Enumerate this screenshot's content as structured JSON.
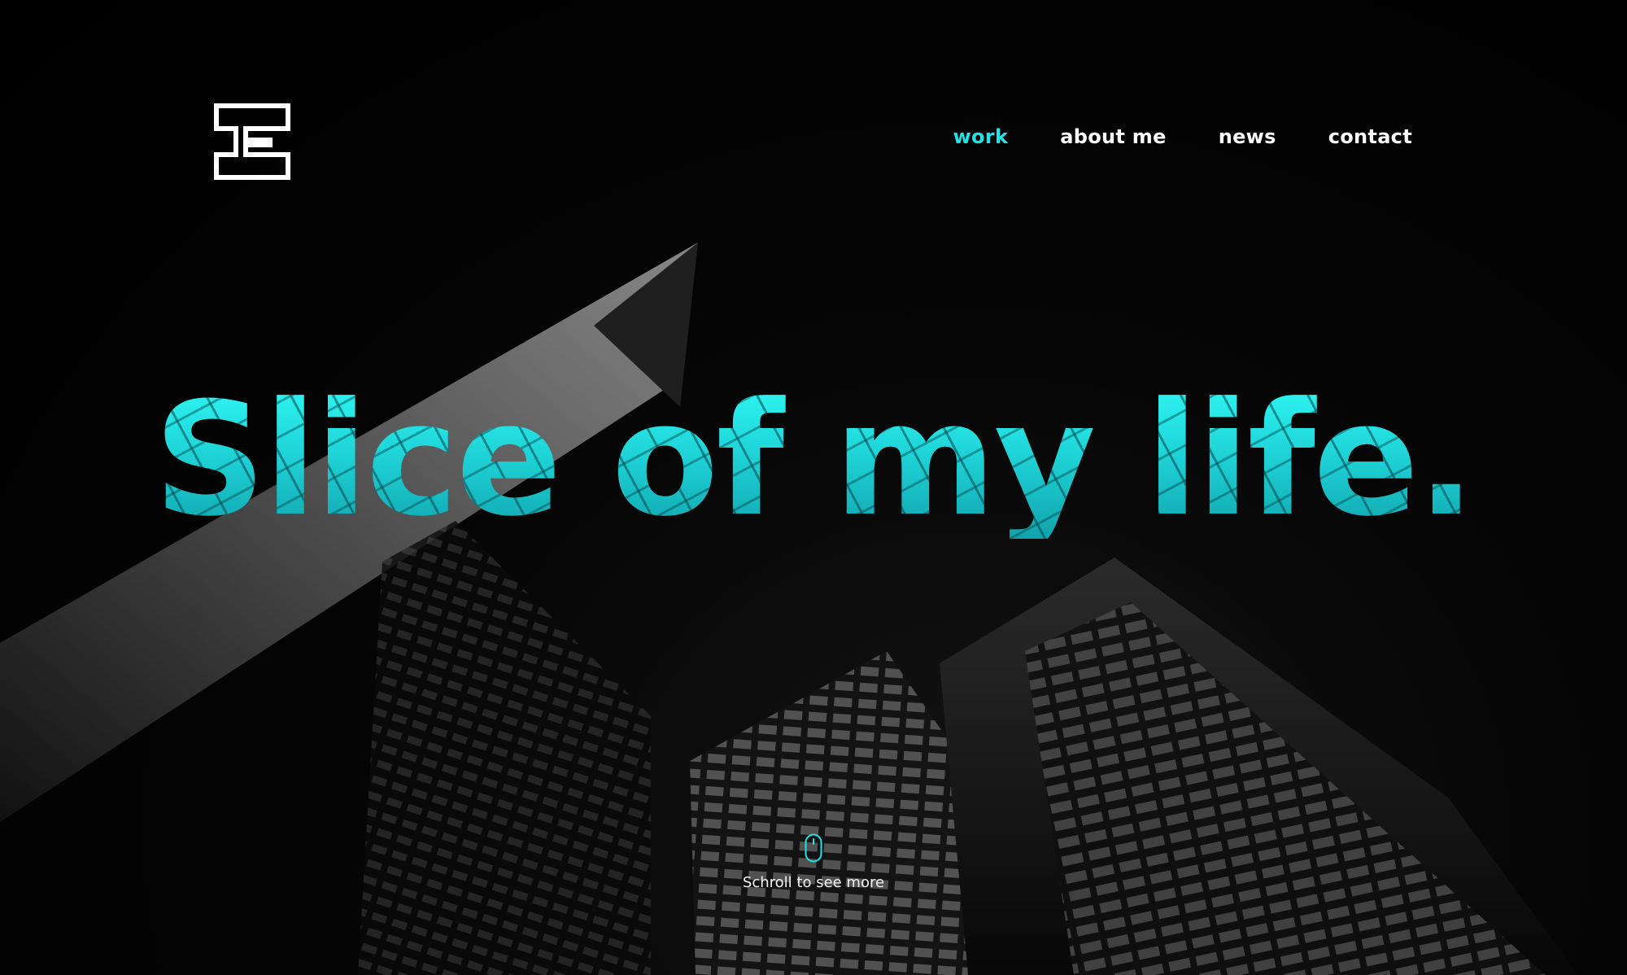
{
  "brand": {
    "logo_icon": "e-monogram-logo"
  },
  "nav": {
    "items": [
      {
        "label": "work",
        "active": true
      },
      {
        "label": "about me",
        "active": false
      },
      {
        "label": "news",
        "active": false
      },
      {
        "label": "contact",
        "active": false
      }
    ]
  },
  "hero": {
    "title": "Slice of my life."
  },
  "scroll_hint": {
    "icon": "mouse-icon",
    "label": "Schroll to see more"
  },
  "colors": {
    "accent": "#1fe3e6",
    "background": "#020202",
    "text": "#ffffff"
  }
}
